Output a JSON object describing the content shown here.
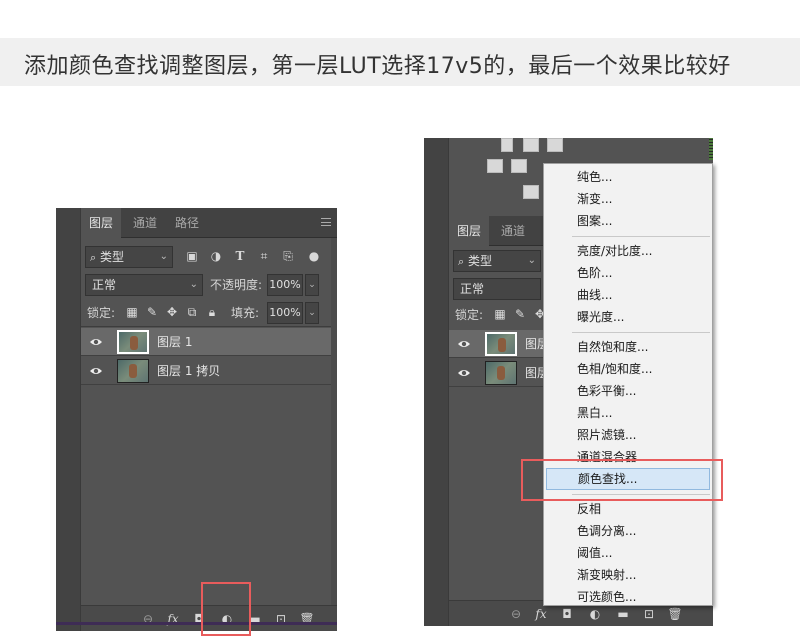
{
  "caption": "添加颜色查找调整图层，第一层LUT选择17v5的，最后一个效果比较好",
  "left_panel": {
    "tabs": [
      "图层",
      "通道",
      "路径"
    ],
    "filter_kind": "类型",
    "blend_mode": "正常",
    "opacity_label": "不透明度:",
    "opacity_value": "100%",
    "lock_label": "锁定:",
    "fill_label": "填充:",
    "fill_value": "100%",
    "layers": [
      {
        "name": "图层 1",
        "selected": true
      },
      {
        "name": "图层 1 拷贝",
        "selected": false
      }
    ]
  },
  "right_panel": {
    "tabs": [
      "图层",
      "通道"
    ],
    "filter_kind": "类型",
    "blend_mode": "正常",
    "lock_label": "锁定:",
    "layers": [
      "图层",
      "图层"
    ]
  },
  "adjustment_menu": {
    "groups": [
      [
        "纯色...",
        "渐变...",
        "图案..."
      ],
      [
        "亮度/对比度...",
        "色阶...",
        "曲线...",
        "曝光度..."
      ],
      [
        "自然饱和度...",
        "色相/饱和度...",
        "色彩平衡...",
        "黑白...",
        "照片滤镜...",
        "通道混合器",
        "颜色查找..."
      ],
      [
        "反相",
        "色调分离...",
        "阈值...",
        "渐变映射...",
        "可选颜色..."
      ]
    ],
    "highlighted": "颜色查找..."
  },
  "colors": {
    "panel_bg": "#535353",
    "menu_bg": "#f2f2f2",
    "highlight_border": "#e85c5c",
    "selected_row": "#696969"
  }
}
